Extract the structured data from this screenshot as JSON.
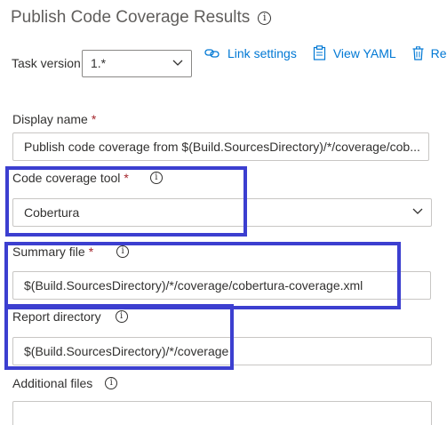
{
  "header": {
    "title": "Publish Code Coverage Results"
  },
  "task_version": {
    "label": "Task version",
    "value": "1.*"
  },
  "toolbar": {
    "link_settings": "Link settings",
    "view_yaml": "View YAML",
    "remove": "Rer"
  },
  "fields": {
    "display_name": {
      "label": "Display name",
      "required": "*",
      "value": "Publish code coverage from $(Build.SourcesDirectory)/*/coverage/cob..."
    },
    "code_coverage_tool": {
      "label": "Code coverage tool",
      "required": "*",
      "value": "Cobertura"
    },
    "summary_file": {
      "label": "Summary file",
      "required": "*",
      "value": "$(Build.SourcesDirectory)/*/coverage/cobertura-coverage.xml"
    },
    "report_directory": {
      "label": "Report directory",
      "value": "$(Build.SourcesDirectory)/*/coverage"
    },
    "additional_files": {
      "label": "Additional files",
      "value": ""
    }
  },
  "icons": {
    "info": "i"
  },
  "colors": {
    "accent": "#0078d4",
    "highlight": "#3c3fd0",
    "required": "#a4262c"
  }
}
